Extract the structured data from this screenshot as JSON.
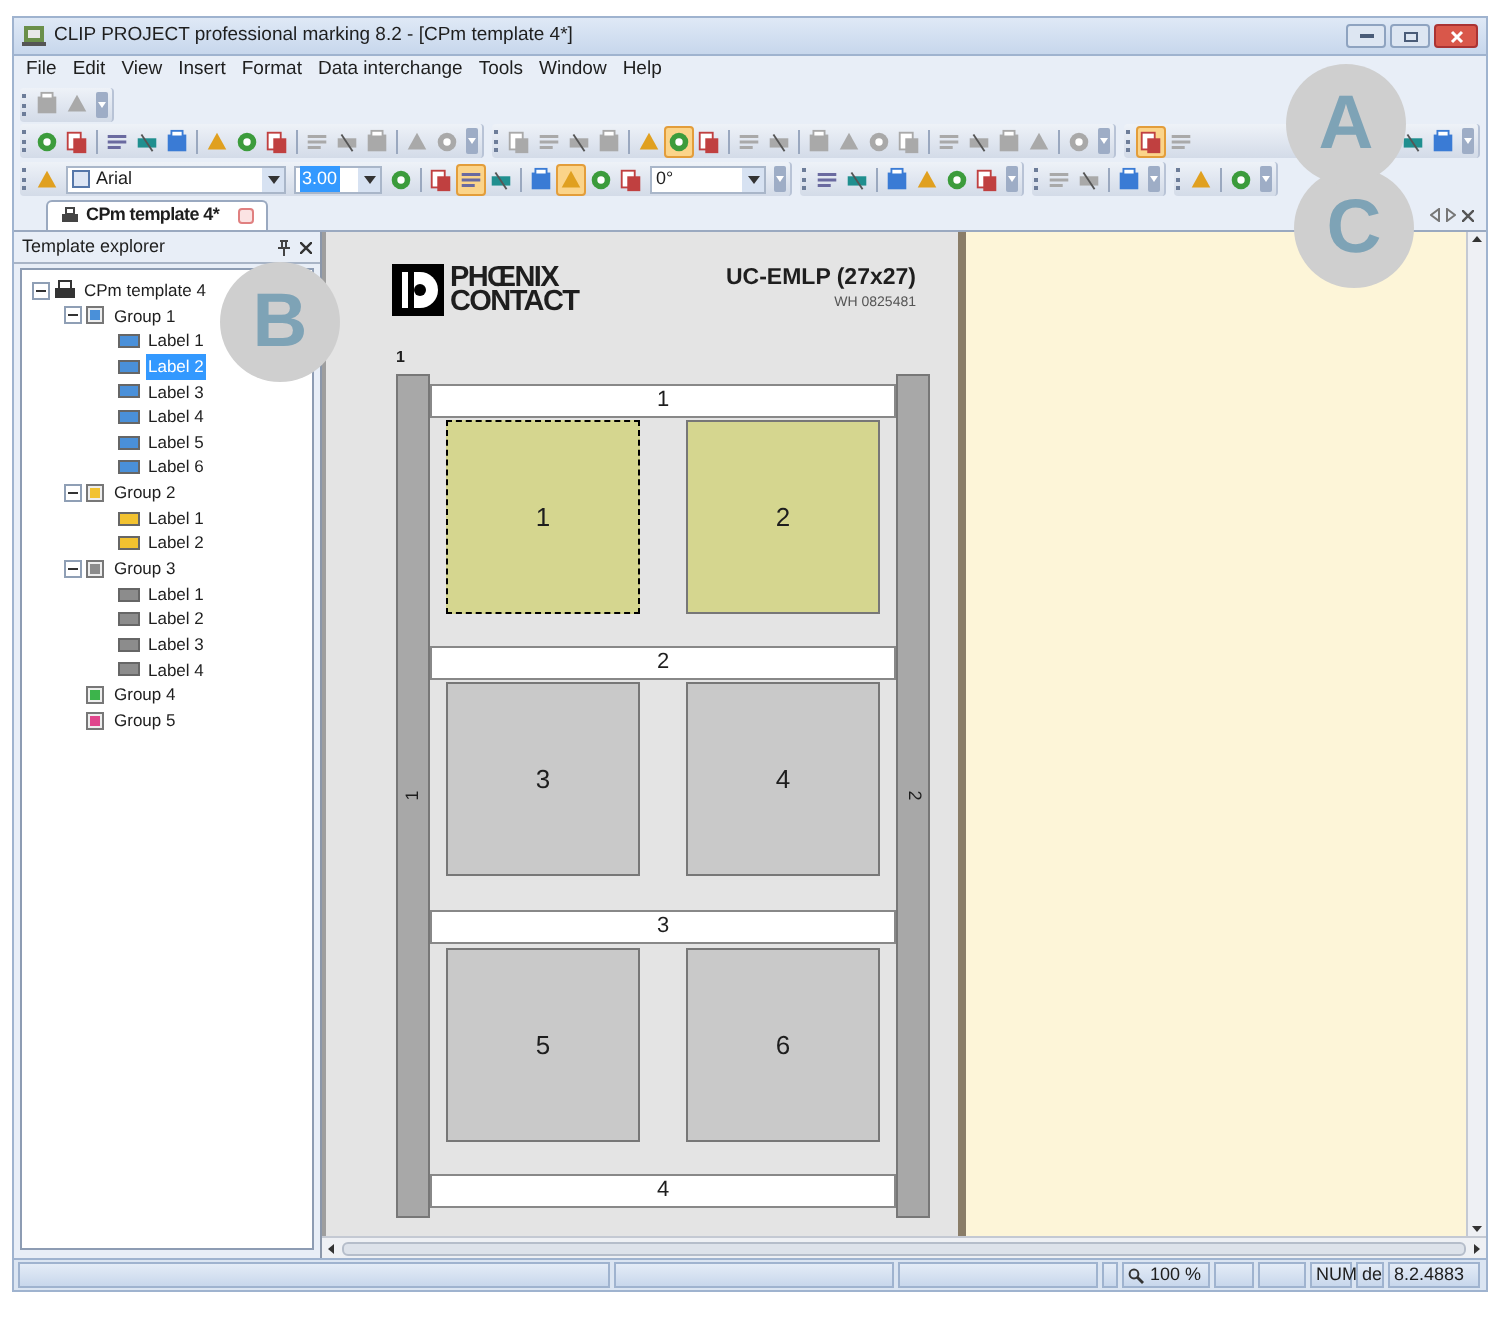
{
  "window": {
    "title": "CLIP PROJECT professional marking 8.2 - [CPm template 4*]"
  },
  "menu": [
    "File",
    "Edit",
    "View",
    "Insert",
    "Format",
    "Data interchange",
    "Tools",
    "Window",
    "Help"
  ],
  "toolbar_rows": [
    [
      [
        {
          "kind": "button",
          "pressed": false,
          "disabled": true
        },
        {
          "kind": "button",
          "pressed": false,
          "disabled": true
        }
      ]
    ],
    [
      [
        {
          "kind": "button",
          "pressed": false
        },
        {
          "kind": "button",
          "pressed": false
        },
        {
          "kind": "separator"
        },
        {
          "kind": "button",
          "pressed": false
        },
        {
          "kind": "button",
          "pressed": false
        },
        {
          "kind": "button",
          "pressed": false
        },
        {
          "kind": "separator"
        },
        {
          "kind": "button",
          "pressed": false
        },
        {
          "kind": "button",
          "pressed": false
        },
        {
          "kind": "button",
          "pressed": false
        },
        {
          "kind": "separator"
        },
        {
          "kind": "button",
          "pressed": false,
          "disabled": true
        },
        {
          "kind": "button",
          "pressed": false,
          "disabled": true
        },
        {
          "kind": "button",
          "pressed": false,
          "disabled": true
        },
        {
          "kind": "separator"
        },
        {
          "kind": "button",
          "pressed": false,
          "disabled": true
        },
        {
          "kind": "button",
          "pressed": false,
          "disabled": true
        }
      ],
      [
        {
          "kind": "button",
          "pressed": false,
          "disabled": true
        },
        {
          "kind": "button",
          "pressed": false,
          "disabled": true
        },
        {
          "kind": "button",
          "pressed": false,
          "disabled": true
        },
        {
          "kind": "button",
          "pressed": false,
          "disabled": true
        },
        {
          "kind": "separator"
        },
        {
          "kind": "button",
          "pressed": false
        },
        {
          "kind": "button",
          "pressed": true
        },
        {
          "kind": "button",
          "pressed": false
        },
        {
          "kind": "separator"
        },
        {
          "kind": "button",
          "pressed": false,
          "disabled": true
        },
        {
          "kind": "button",
          "pressed": false,
          "disabled": true
        },
        {
          "kind": "separator"
        },
        {
          "kind": "button",
          "pressed": false,
          "disabled": true
        },
        {
          "kind": "button",
          "pressed": false,
          "disabled": true
        },
        {
          "kind": "button",
          "pressed": false,
          "disabled": true
        },
        {
          "kind": "button",
          "pressed": false,
          "disabled": true
        },
        {
          "kind": "separator"
        },
        {
          "kind": "button",
          "pressed": false,
          "disabled": true
        },
        {
          "kind": "button",
          "pressed": false,
          "disabled": true
        },
        {
          "kind": "button",
          "pressed": false,
          "disabled": true
        },
        {
          "kind": "button",
          "pressed": false,
          "disabled": true
        },
        {
          "kind": "separator"
        },
        {
          "kind": "button",
          "pressed": false,
          "disabled": true
        }
      ],
      [
        {
          "kind": "button",
          "pressed": true
        },
        {
          "kind": "button",
          "pressed": false,
          "disabled": true
        },
        {
          "kind": "spacer"
        },
        {
          "kind": "button",
          "pressed": false
        },
        {
          "kind": "button",
          "pressed": false
        }
      ]
    ],
    [
      [
        {
          "kind": "button",
          "pressed": false
        },
        {
          "kind": "font",
          "value": "Arial"
        },
        {
          "kind": "size",
          "value": "3.00"
        },
        {
          "kind": "button",
          "pressed": false
        },
        {
          "kind": "separator"
        },
        {
          "kind": "button",
          "pressed": false
        },
        {
          "kind": "button",
          "pressed": true
        },
        {
          "kind": "button",
          "pressed": false
        },
        {
          "kind": "separator"
        },
        {
          "kind": "button",
          "pressed": false
        },
        {
          "kind": "button",
          "pressed": true
        },
        {
          "kind": "button",
          "pressed": false
        },
        {
          "kind": "button",
          "pressed": false
        },
        {
          "kind": "angle",
          "value": "0°"
        }
      ],
      [
        {
          "kind": "button",
          "pressed": false
        },
        {
          "kind": "button",
          "pressed": false
        },
        {
          "kind": "separator"
        },
        {
          "kind": "button",
          "pressed": false
        },
        {
          "kind": "button",
          "pressed": false
        },
        {
          "kind": "button",
          "pressed": false
        },
        {
          "kind": "button",
          "pressed": false
        }
      ],
      [
        {
          "kind": "button",
          "pressed": false,
          "disabled": true
        },
        {
          "kind": "button",
          "pressed": false,
          "disabled": true
        },
        {
          "kind": "separator"
        },
        {
          "kind": "button",
          "pressed": false
        }
      ],
      [
        {
          "kind": "button",
          "pressed": false
        },
        {
          "kind": "separator"
        },
        {
          "kind": "button",
          "pressed": false
        }
      ]
    ]
  ],
  "document_tabs": [
    {
      "label": "CPm template 4*",
      "selected": true
    }
  ],
  "template_explorer": {
    "title": "Template explorer",
    "tree": [
      {
        "label": "CPm template 4",
        "kind": "template",
        "expanded": true,
        "selected": false,
        "children": [
          {
            "label": "Group 1",
            "kind": "group",
            "color": "#4a90d9",
            "expanded": true,
            "selected": false,
            "children": [
              {
                "label": "Label 1",
                "kind": "label",
                "color": "#4a90d9",
                "selected": false
              },
              {
                "label": "Label 2",
                "kind": "label",
                "color": "#4a90d9",
                "selected": true
              },
              {
                "label": "Label 3",
                "kind": "label",
                "color": "#4a90d9",
                "selected": false
              },
              {
                "label": "Label 4",
                "kind": "label",
                "color": "#4a90d9",
                "selected": false
              },
              {
                "label": "Label 5",
                "kind": "label",
                "color": "#4a90d9",
                "selected": false
              },
              {
                "label": "Label 6",
                "kind": "label",
                "color": "#4a90d9",
                "selected": false
              }
            ]
          },
          {
            "label": "Group 2",
            "kind": "group",
            "color": "#f2c230",
            "expanded": true,
            "selected": false,
            "children": [
              {
                "label": "Label 1",
                "kind": "label",
                "color": "#f2c230",
                "selected": false
              },
              {
                "label": "Label 2",
                "kind": "label",
                "color": "#f2c230",
                "selected": false
              }
            ]
          },
          {
            "label": "Group 3",
            "kind": "group",
            "color": "#8c8c8c",
            "expanded": true,
            "selected": false,
            "children": [
              {
                "label": "Label 1",
                "kind": "label",
                "color": "#8c8c8c",
                "selected": false
              },
              {
                "label": "Label 2",
                "kind": "label",
                "color": "#8c8c8c",
                "selected": false
              },
              {
                "label": "Label 3",
                "kind": "label",
                "color": "#8c8c8c",
                "selected": false
              },
              {
                "label": "Label 4",
                "kind": "label",
                "color": "#8c8c8c",
                "selected": false
              }
            ]
          },
          {
            "label": "Group 4",
            "kind": "group",
            "color": "#3cb44b",
            "selected": false
          },
          {
            "label": "Group 5",
            "kind": "group",
            "color": "#e0458c",
            "selected": false
          }
        ]
      }
    ]
  },
  "sheet": {
    "logo": [
      "PHŒNIX",
      "CONTACT"
    ],
    "title": "UC-EMLP (27x27)",
    "article": "WH 0825481",
    "sheet_number": "1",
    "rails": [
      "1",
      "2"
    ],
    "strips": [
      "1",
      "2",
      "3",
      "4"
    ],
    "cells": [
      {
        "label": "1",
        "color": "#d5d68f",
        "selected": true
      },
      {
        "label": "2",
        "color": "#d5d68f",
        "selected": false
      },
      {
        "label": "3",
        "color": "#c9c9c9",
        "selected": false
      },
      {
        "label": "4",
        "color": "#c9c9c9",
        "selected": false
      },
      {
        "label": "5",
        "color": "#c9c9c9",
        "selected": false
      },
      {
        "label": "6",
        "color": "#c9c9c9",
        "selected": false
      }
    ]
  },
  "status_bar": {
    "zoom": "100 %",
    "panes": [
      "NUM",
      "de",
      "8.2.4883"
    ]
  },
  "callouts": [
    "A",
    "B",
    "C"
  ]
}
